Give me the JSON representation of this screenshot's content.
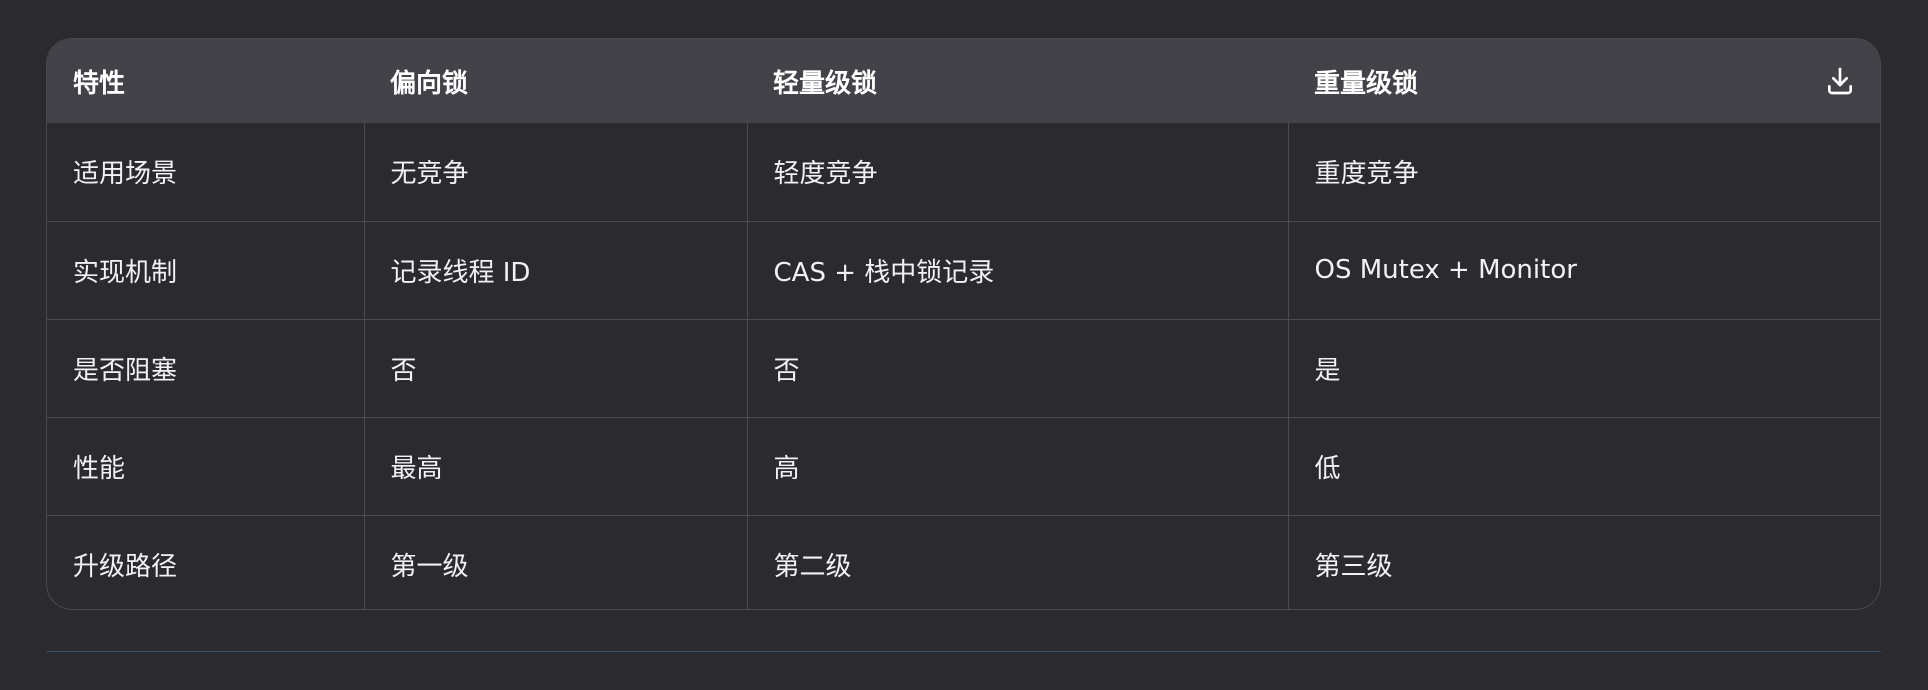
{
  "table": {
    "headers": [
      "特性",
      "偏向锁",
      "轻量级锁",
      "重量级锁"
    ],
    "rows": [
      [
        "适用场景",
        "无竞争",
        "轻度竞争",
        "重度竞争"
      ],
      [
        "实现机制",
        "记录线程 ID",
        "CAS + 栈中锁记录",
        "OS Mutex + Monitor"
      ],
      [
        "是否阻塞",
        "否",
        "否",
        "是"
      ],
      [
        "性能",
        "最高",
        "高",
        "低"
      ],
      [
        "升级路径",
        "第一级",
        "第二级",
        "第三级"
      ]
    ]
  },
  "icons": {
    "download": "download-icon"
  },
  "colors": {
    "background": "#2b2a2f",
    "header_background": "#424248",
    "border": "#4a4a50",
    "divider": "#3d4b5e",
    "text": "#f2f2f4"
  }
}
